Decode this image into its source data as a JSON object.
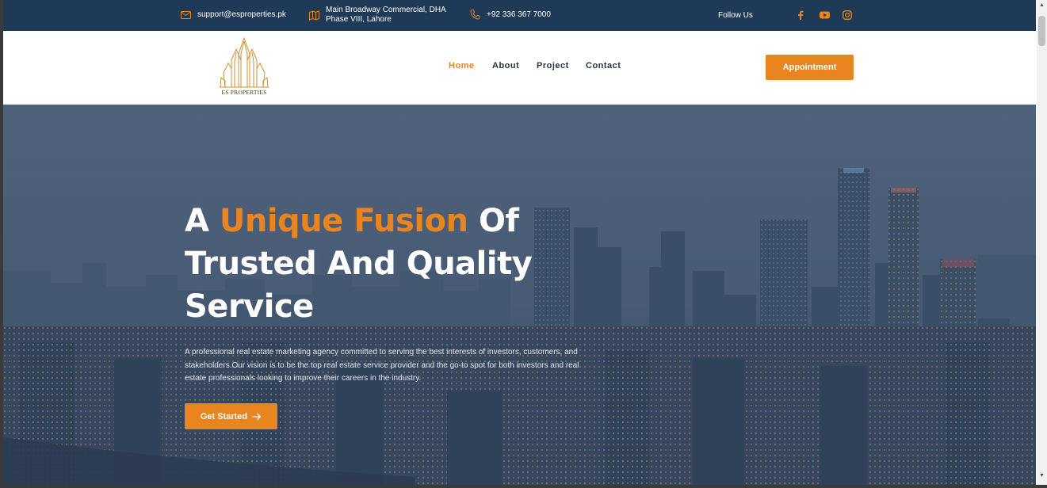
{
  "topbar": {
    "email": "support@esproperties.pk",
    "address_line1": "Main Broadway Commercial, DHA",
    "address_line2": "Phase VIII, Lahore",
    "phone": "+92 336 367 7000",
    "follow_label": "Follow Us",
    "socials": [
      "facebook-icon",
      "youtube-icon",
      "instagram-icon"
    ]
  },
  "brand": {
    "logo_text": "ES PROPERTIES"
  },
  "nav": {
    "items": [
      {
        "label": "Home",
        "active": true
      },
      {
        "label": "About",
        "active": false
      },
      {
        "label": "Project",
        "active": false
      },
      {
        "label": "Contact",
        "active": false
      }
    ],
    "appointment_label": "Appointment"
  },
  "hero": {
    "headline_pre": "A ",
    "headline_accent": "Unique Fusion",
    "headline_post_line1": " Of",
    "headline_line2": "Trusted And Quality",
    "headline_line3": "Service",
    "description": "A professional real estate marketing agency committed to serving the best interests of investors, customers, and stakeholders.Our vision is to be the top real estate service provider and the go-to spot for both investors and real estate professionals looking to improve their careers in the industry.",
    "cta_label": "Get Started"
  },
  "colors": {
    "accent": "#e8851f",
    "topbar_bg": "#1f3a56",
    "nav_text": "#2b3442"
  }
}
